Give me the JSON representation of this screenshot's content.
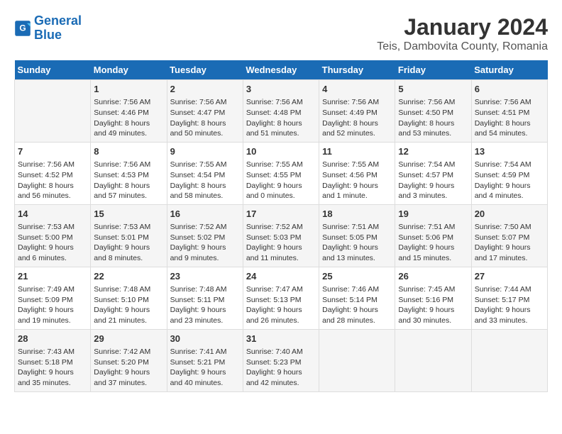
{
  "logo": {
    "line1": "General",
    "line2": "Blue"
  },
  "title": "January 2024",
  "subtitle": "Teis, Dambovita County, Romania",
  "days_of_week": [
    "Sunday",
    "Monday",
    "Tuesday",
    "Wednesday",
    "Thursday",
    "Friday",
    "Saturday"
  ],
  "weeks": [
    [
      {
        "day": "",
        "lines": []
      },
      {
        "day": "1",
        "lines": [
          "Sunrise: 7:56 AM",
          "Sunset: 4:46 PM",
          "Daylight: 8 hours",
          "and 49 minutes."
        ]
      },
      {
        "day": "2",
        "lines": [
          "Sunrise: 7:56 AM",
          "Sunset: 4:47 PM",
          "Daylight: 8 hours",
          "and 50 minutes."
        ]
      },
      {
        "day": "3",
        "lines": [
          "Sunrise: 7:56 AM",
          "Sunset: 4:48 PM",
          "Daylight: 8 hours",
          "and 51 minutes."
        ]
      },
      {
        "day": "4",
        "lines": [
          "Sunrise: 7:56 AM",
          "Sunset: 4:49 PM",
          "Daylight: 8 hours",
          "and 52 minutes."
        ]
      },
      {
        "day": "5",
        "lines": [
          "Sunrise: 7:56 AM",
          "Sunset: 4:50 PM",
          "Daylight: 8 hours",
          "and 53 minutes."
        ]
      },
      {
        "day": "6",
        "lines": [
          "Sunrise: 7:56 AM",
          "Sunset: 4:51 PM",
          "Daylight: 8 hours",
          "and 54 minutes."
        ]
      }
    ],
    [
      {
        "day": "7",
        "lines": [
          "Sunrise: 7:56 AM",
          "Sunset: 4:52 PM",
          "Daylight: 8 hours",
          "and 56 minutes."
        ]
      },
      {
        "day": "8",
        "lines": [
          "Sunrise: 7:56 AM",
          "Sunset: 4:53 PM",
          "Daylight: 8 hours",
          "and 57 minutes."
        ]
      },
      {
        "day": "9",
        "lines": [
          "Sunrise: 7:55 AM",
          "Sunset: 4:54 PM",
          "Daylight: 8 hours",
          "and 58 minutes."
        ]
      },
      {
        "day": "10",
        "lines": [
          "Sunrise: 7:55 AM",
          "Sunset: 4:55 PM",
          "Daylight: 9 hours",
          "and 0 minutes."
        ]
      },
      {
        "day": "11",
        "lines": [
          "Sunrise: 7:55 AM",
          "Sunset: 4:56 PM",
          "Daylight: 9 hours",
          "and 1 minute."
        ]
      },
      {
        "day": "12",
        "lines": [
          "Sunrise: 7:54 AM",
          "Sunset: 4:57 PM",
          "Daylight: 9 hours",
          "and 3 minutes."
        ]
      },
      {
        "day": "13",
        "lines": [
          "Sunrise: 7:54 AM",
          "Sunset: 4:59 PM",
          "Daylight: 9 hours",
          "and 4 minutes."
        ]
      }
    ],
    [
      {
        "day": "14",
        "lines": [
          "Sunrise: 7:53 AM",
          "Sunset: 5:00 PM",
          "Daylight: 9 hours",
          "and 6 minutes."
        ]
      },
      {
        "day": "15",
        "lines": [
          "Sunrise: 7:53 AM",
          "Sunset: 5:01 PM",
          "Daylight: 9 hours",
          "and 8 minutes."
        ]
      },
      {
        "day": "16",
        "lines": [
          "Sunrise: 7:52 AM",
          "Sunset: 5:02 PM",
          "Daylight: 9 hours",
          "and 9 minutes."
        ]
      },
      {
        "day": "17",
        "lines": [
          "Sunrise: 7:52 AM",
          "Sunset: 5:03 PM",
          "Daylight: 9 hours",
          "and 11 minutes."
        ]
      },
      {
        "day": "18",
        "lines": [
          "Sunrise: 7:51 AM",
          "Sunset: 5:05 PM",
          "Daylight: 9 hours",
          "and 13 minutes."
        ]
      },
      {
        "day": "19",
        "lines": [
          "Sunrise: 7:51 AM",
          "Sunset: 5:06 PM",
          "Daylight: 9 hours",
          "and 15 minutes."
        ]
      },
      {
        "day": "20",
        "lines": [
          "Sunrise: 7:50 AM",
          "Sunset: 5:07 PM",
          "Daylight: 9 hours",
          "and 17 minutes."
        ]
      }
    ],
    [
      {
        "day": "21",
        "lines": [
          "Sunrise: 7:49 AM",
          "Sunset: 5:09 PM",
          "Daylight: 9 hours",
          "and 19 minutes."
        ]
      },
      {
        "day": "22",
        "lines": [
          "Sunrise: 7:48 AM",
          "Sunset: 5:10 PM",
          "Daylight: 9 hours",
          "and 21 minutes."
        ]
      },
      {
        "day": "23",
        "lines": [
          "Sunrise: 7:48 AM",
          "Sunset: 5:11 PM",
          "Daylight: 9 hours",
          "and 23 minutes."
        ]
      },
      {
        "day": "24",
        "lines": [
          "Sunrise: 7:47 AM",
          "Sunset: 5:13 PM",
          "Daylight: 9 hours",
          "and 26 minutes."
        ]
      },
      {
        "day": "25",
        "lines": [
          "Sunrise: 7:46 AM",
          "Sunset: 5:14 PM",
          "Daylight: 9 hours",
          "and 28 minutes."
        ]
      },
      {
        "day": "26",
        "lines": [
          "Sunrise: 7:45 AM",
          "Sunset: 5:16 PM",
          "Daylight: 9 hours",
          "and 30 minutes."
        ]
      },
      {
        "day": "27",
        "lines": [
          "Sunrise: 7:44 AM",
          "Sunset: 5:17 PM",
          "Daylight: 9 hours",
          "and 33 minutes."
        ]
      }
    ],
    [
      {
        "day": "28",
        "lines": [
          "Sunrise: 7:43 AM",
          "Sunset: 5:18 PM",
          "Daylight: 9 hours",
          "and 35 minutes."
        ]
      },
      {
        "day": "29",
        "lines": [
          "Sunrise: 7:42 AM",
          "Sunset: 5:20 PM",
          "Daylight: 9 hours",
          "and 37 minutes."
        ]
      },
      {
        "day": "30",
        "lines": [
          "Sunrise: 7:41 AM",
          "Sunset: 5:21 PM",
          "Daylight: 9 hours",
          "and 40 minutes."
        ]
      },
      {
        "day": "31",
        "lines": [
          "Sunrise: 7:40 AM",
          "Sunset: 5:23 PM",
          "Daylight: 9 hours",
          "and 42 minutes."
        ]
      },
      {
        "day": "",
        "lines": []
      },
      {
        "day": "",
        "lines": []
      },
      {
        "day": "",
        "lines": []
      }
    ]
  ]
}
